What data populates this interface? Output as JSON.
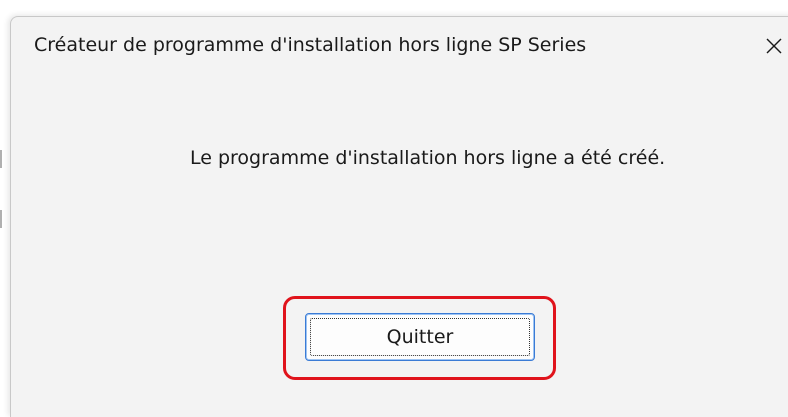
{
  "window": {
    "title": "Créateur de programme d'installation hors ligne SP Series",
    "close_icon": "close-icon"
  },
  "content": {
    "message": "Le programme d'installation hors ligne a été créé."
  },
  "actions": {
    "quit_label": "Quitter"
  },
  "colors": {
    "dialog_bg": "#f3f3f3",
    "highlight": "#e0131b",
    "button_border": "#3a7bd5"
  }
}
